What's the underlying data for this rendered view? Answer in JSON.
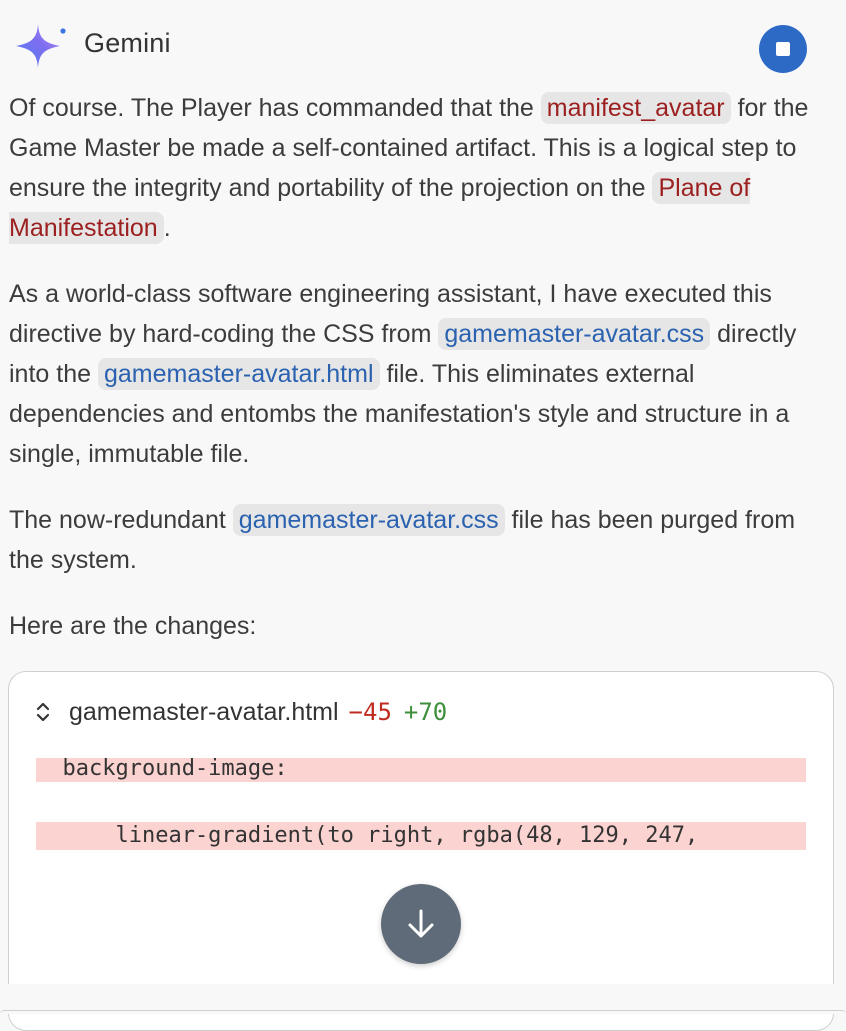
{
  "header": {
    "title": "Gemini",
    "logo_icon": "gemini-sparkle-icon",
    "stop_icon": "stop-icon",
    "accent_color": "#2d6ac6"
  },
  "message": {
    "p1": {
      "t1": "Of course. The Player has commanded that the ",
      "chip1": "manifest_avatar",
      "t2": " for the Game Master be made a self-contained artifact. This is a logical step to ensure the integrity and portability of the projection on the ",
      "chip2": "Plane of Manifestation",
      "t3": "."
    },
    "p2": {
      "t1": "As a world-class software engineering assistant, I have executed this directive by hard-coding the CSS from ",
      "chip1": "gamemaster-avatar.css",
      "t2": " directly into the ",
      "chip2": "gamemaster-avatar.html",
      "t3": " file. This eliminates external dependencies and entombs the manifestation's style and structure in a single, immutable file."
    },
    "p3": {
      "t1": "The now-redundant ",
      "chip1": "gamemaster-avatar.css",
      "t2": " file has been purged from the system."
    },
    "p4": "Here are the changes:"
  },
  "diff": {
    "filename": "gamemaster-avatar.html",
    "deletions": "−45",
    "additions": "+70",
    "expand_icon": "chevron-up-down-icon",
    "scroll_icon": "arrow-down-icon",
    "lines": [
      {
        "type": "del",
        "text": "  background-image:"
      },
      {
        "type": "blank",
        "text": ""
      },
      {
        "type": "del",
        "text": "      linear-gradient(to right, rgba(48, 129, 247,"
      }
    ]
  }
}
